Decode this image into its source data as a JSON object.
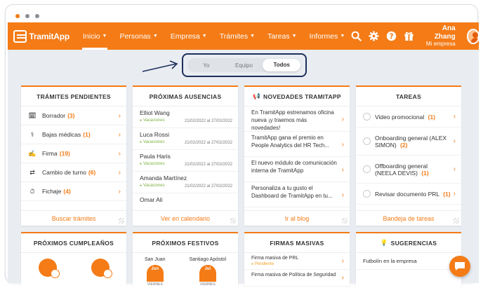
{
  "nav": {
    "logo_text": "TramitApp",
    "menu": [
      {
        "label": "Inicio",
        "active": true
      },
      {
        "label": "Personas"
      },
      {
        "label": "Empresa"
      },
      {
        "label": "Trámites"
      },
      {
        "label": "Tareas"
      },
      {
        "label": "Informes"
      }
    ],
    "user_name": "Ana Zhang",
    "user_company": "Mi empresa"
  },
  "scope_toggle": {
    "options": [
      "Yo",
      "Equipo",
      "Todos"
    ],
    "selected": "Todos"
  },
  "cards": {
    "tramites": {
      "title": "TRÁMITES PENDIENTES",
      "items": [
        {
          "label": "Borrador",
          "count": "(3)",
          "icon": "draft-icon"
        },
        {
          "label": "Bajas médicas",
          "count": "(1)",
          "icon": "medical-icon"
        },
        {
          "label": "Firma",
          "count": "(19)",
          "icon": "signature-icon"
        },
        {
          "label": "Cambio de turno",
          "count": "(6)",
          "icon": "shift-icon"
        },
        {
          "label": "Fichaje",
          "count": "(4)",
          "icon": "clock-icon"
        }
      ],
      "footer": "Buscar trámites"
    },
    "ausencias": {
      "title": "PRÓXIMAS AUSENCIAS",
      "items": [
        {
          "name": "Elliot Wang",
          "type": "Vacaciones",
          "dates": "21/02/2022 al 27/02/2022"
        },
        {
          "name": "Luca Rossi",
          "type": "Vacaciones",
          "dates": "21/02/2022 al 27/02/2022"
        },
        {
          "name": "Paula Haris",
          "type": "Vacaciones",
          "dates": "21/02/2022 al 27/02/2022"
        },
        {
          "name": "Amanda Martínez",
          "type": "Vacaciones",
          "dates": "21/02/2022 al 27/02/2022"
        },
        {
          "name": "Omar Ali",
          "type": "",
          "dates": ""
        }
      ],
      "footer": "Ver en calendario"
    },
    "novedades": {
      "title": "NOVEDADES TRAMITAPP",
      "items": [
        "En TramitApp estrenamos oficina nueva ¡y traemos más novedades!",
        "TramitApp gana el premio en People Analytics del HR Tech...",
        "El nuevo módulo de comunicación interna de TramitApp",
        "Personaliza a tu gusto el Dashboard de TramitApp en tu..."
      ],
      "footer": "Ir al blog"
    },
    "tareas": {
      "title": "TAREAS",
      "items": [
        {
          "label": "Video promocional",
          "count": "(1)"
        },
        {
          "label": "Onboarding general (ALEX SIMON)",
          "count": "(2)"
        },
        {
          "label": "Offboarding general (NEELA DEVIS)",
          "count": "(1)"
        },
        {
          "label": "Revisar documento PRL",
          "count": "(1)"
        }
      ],
      "footer": "Bandeja de tareas"
    },
    "cumpleanos": {
      "title": "PRÓXIMOS CUMPLEAÑOS"
    },
    "festivos": {
      "title": "PRÓXIMOS FESTIVOS",
      "items": [
        {
          "name": "San Juan",
          "month": "Jun",
          "day": "VIERNES"
        },
        {
          "name": "Santiago Apóstol",
          "month": "Jul",
          "day": "VIERNES"
        }
      ]
    },
    "firmas": {
      "title": "FIRMAS MASIVAS",
      "items": [
        {
          "label": "Firma masiva de PRL",
          "status": "Pendiente"
        },
        {
          "label": "Firma masiva de Política de Seguridad",
          "status": ""
        }
      ]
    },
    "sugerencias": {
      "title": "SUGERENCIAS",
      "items": [
        "Futbolín en la empresa"
      ]
    }
  },
  "colors": {
    "brand": "#f47b16",
    "frame_highlight": "#1e2f5c"
  }
}
